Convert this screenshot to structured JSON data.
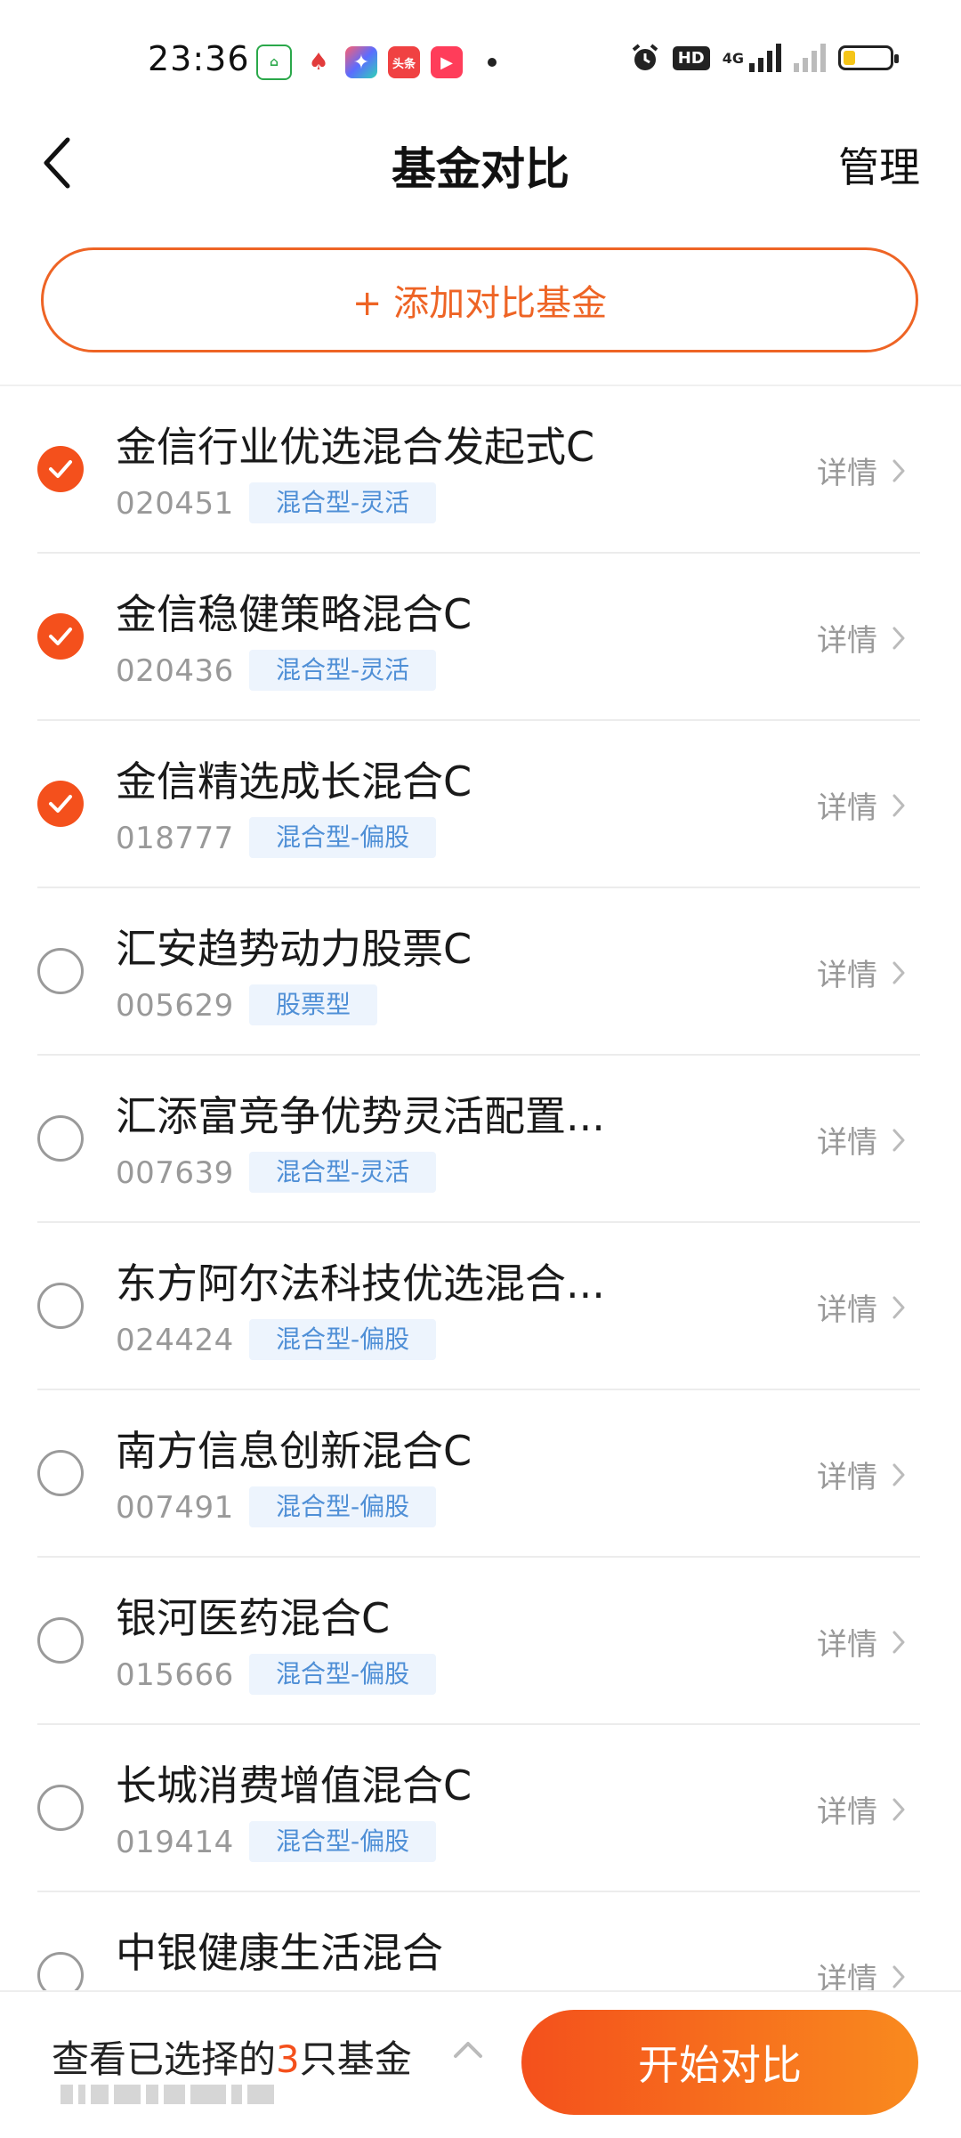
{
  "status_bar": {
    "time": "23:36",
    "apps": [
      {
        "icon": "home-app-icon",
        "color": "#2aa84a"
      },
      {
        "icon": "bank-app-icon",
        "color": "#e23b3b"
      },
      {
        "icon": "star-app-icon",
        "color": "#5b6cff"
      },
      {
        "icon": "toutiao-app-icon",
        "color": "#f04142",
        "text": "头条"
      },
      {
        "icon": "video-app-icon",
        "color": "#ff3d5a"
      }
    ],
    "hd_label": "HD",
    "network_label": "4G",
    "battery_level_percent": 25
  },
  "header": {
    "title": "基金对比",
    "manage_label": "管理"
  },
  "add_button_label": "+ 添加对比基金",
  "funds": [
    {
      "name": "金信行业优选混合发起式C",
      "code": "020451",
      "tag": "混合型-灵活",
      "selected": true,
      "detail": "详情"
    },
    {
      "name": "金信稳健策略混合C",
      "code": "020436",
      "tag": "混合型-灵活",
      "selected": true,
      "detail": "详情"
    },
    {
      "name": "金信精选成长混合C",
      "code": "018777",
      "tag": "混合型-偏股",
      "selected": true,
      "detail": "详情"
    },
    {
      "name": "汇安趋势动力股票C",
      "code": "005629",
      "tag": "股票型",
      "selected": false,
      "detail": "详情"
    },
    {
      "name": "汇添富竞争优势灵活配置...",
      "code": "007639",
      "tag": "混合型-灵活",
      "selected": false,
      "detail": "详情"
    },
    {
      "name": "东方阿尔法科技优选混合...",
      "code": "024424",
      "tag": "混合型-偏股",
      "selected": false,
      "detail": "详情"
    },
    {
      "name": "南方信息创新混合C",
      "code": "007491",
      "tag": "混合型-偏股",
      "selected": false,
      "detail": "详情"
    },
    {
      "name": "银河医药混合C",
      "code": "015666",
      "tag": "混合型-偏股",
      "selected": false,
      "detail": "详情"
    },
    {
      "name": "长城消费增值混合C",
      "code": "019414",
      "tag": "混合型-偏股",
      "selected": false,
      "detail": "详情"
    },
    {
      "name": "中银健康生活混合",
      "code": "",
      "tag": "",
      "selected": false,
      "detail": "详情"
    }
  ],
  "bottom_bar": {
    "selected_prefix": "查看已选择的",
    "selected_count": "3",
    "selected_suffix": "只基金",
    "start_button_label": "开始对比"
  },
  "colors": {
    "accent": "#f4501c",
    "accent_gradient_end": "#f98a1e",
    "tag_bg": "#edf4fd",
    "tag_text": "#4f8fd6"
  }
}
